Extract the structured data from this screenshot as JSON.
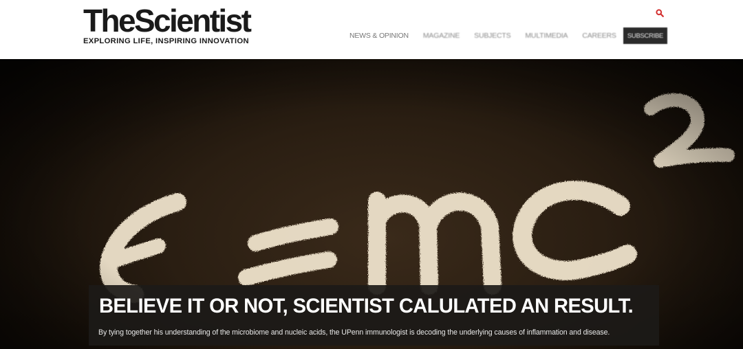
{
  "header": {
    "logo_wordmark": "TheScientist",
    "logo_tagline": "EXPLORING LIFE, INSPIRING INNOVATION",
    "search_icon": "search-icon",
    "nav": {
      "items": [
        "NEWS & OPINION",
        "MAGAZINE",
        "SUBJECTS",
        "MULTIMEDIA",
        "CAREERS"
      ],
      "subscribe_label": "SUBSCRIBE"
    }
  },
  "hero": {
    "image_subject": "chalkboard-equation",
    "headline": "BELIEVE IT OR NOT, SCIENTIST CALULATED AN RESULT.",
    "summary": "By tying together his understanding of the microbiome and nucleic acids, the UPenn immunologist is decoding the underlying causes of inflammation and disease."
  },
  "colors": {
    "search_accent": "#d32f2f",
    "subscribe_bg": "#2b2b2b",
    "caption_bg": "#1c1a18",
    "chalk": "#f2e6cf"
  }
}
